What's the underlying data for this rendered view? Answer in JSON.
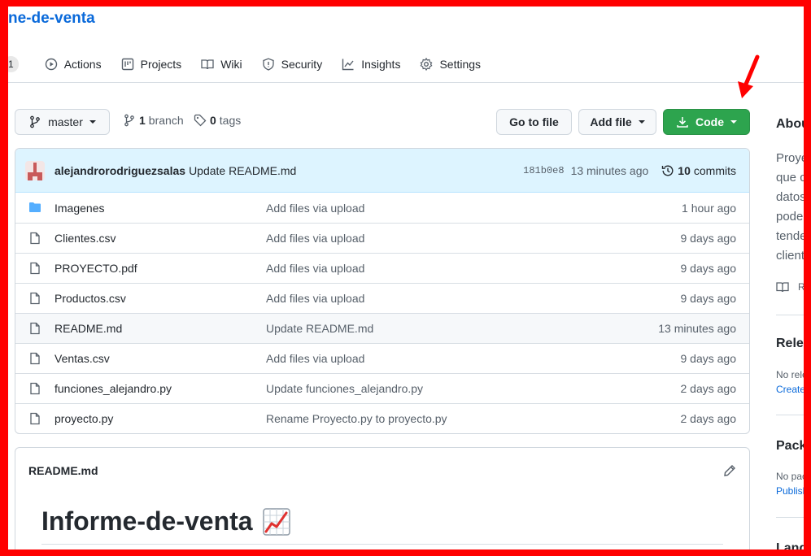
{
  "repo": {
    "title": "ne-de-venta"
  },
  "nav": {
    "count_badge": "1",
    "items": [
      {
        "label": "Actions",
        "icon": "play-icon"
      },
      {
        "label": "Projects",
        "icon": "project-icon"
      },
      {
        "label": "Wiki",
        "icon": "book-icon"
      },
      {
        "label": "Security",
        "icon": "shield-icon"
      },
      {
        "label": "Insights",
        "icon": "graph-icon"
      },
      {
        "label": "Settings",
        "icon": "gear-icon"
      }
    ]
  },
  "toolbar": {
    "branch": "master",
    "branch_count": "1",
    "branch_word": "branch",
    "tag_count": "0",
    "tag_word": "tags",
    "go_to_file": "Go to file",
    "add_file": "Add file",
    "code": "Code"
  },
  "commit": {
    "author": "alejandrorodriguezsalas",
    "message": "Update README.md",
    "sha": "181b0e8",
    "time": "13 minutes ago",
    "count": "10",
    "count_word": "commits"
  },
  "files": [
    {
      "name": "Imagenes",
      "type": "folder",
      "message": "Add files via upload",
      "age": "1 hour ago"
    },
    {
      "name": "Clientes.csv",
      "type": "file",
      "message": "Add files via upload",
      "age": "9 days ago"
    },
    {
      "name": "PROYECTO.pdf",
      "type": "file",
      "message": "Add files via upload",
      "age": "9 days ago"
    },
    {
      "name": "Productos.csv",
      "type": "file",
      "message": "Add files via upload",
      "age": "9 days ago"
    },
    {
      "name": "README.md",
      "type": "file",
      "message": "Update README.md",
      "age": "13 minutes ago"
    },
    {
      "name": "Ventas.csv",
      "type": "file",
      "message": "Add files via upload",
      "age": "9 days ago"
    },
    {
      "name": "funciones_alejandro.py",
      "type": "file",
      "message": "Update funciones_alejandro.py",
      "age": "2 days ago"
    },
    {
      "name": "proyecto.py",
      "type": "file",
      "message": "Rename Proyecto.py to proyecto.py",
      "age": "2 days ago"
    }
  ],
  "readme": {
    "filename": "README.md",
    "heading": "Informe-de-venta"
  },
  "sidebar": {
    "about": "Abou",
    "desc_lines": [
      "Proye",
      "que c",
      "datos",
      "pode",
      "tende",
      "client"
    ],
    "readme_link": "R",
    "releases": "Relea",
    "releases_sub": "No rele",
    "releases_link": "Create",
    "packages": "Packa",
    "packages_sub": "No pac",
    "packages_link": "Publish",
    "languages": "Lang"
  },
  "colors": {
    "accent": "#0969da",
    "code_button": "#2da44e",
    "frame": "#ff0000",
    "commit_bar": "#ddf4ff"
  }
}
